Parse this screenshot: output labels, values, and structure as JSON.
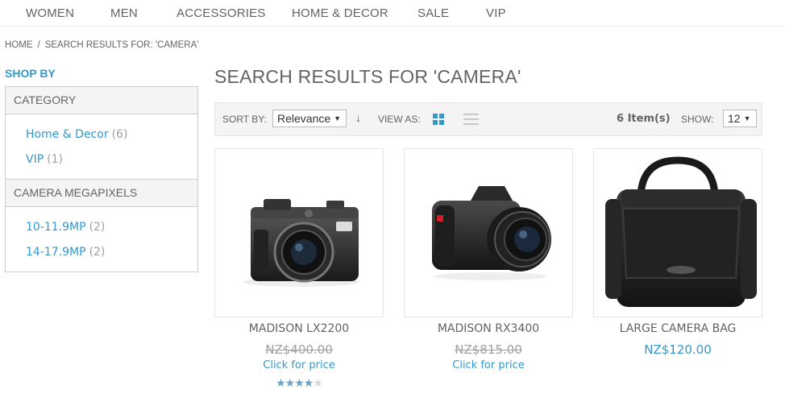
{
  "nav": {
    "items": [
      "WOMEN",
      "MEN",
      "ACCESSORIES",
      "HOME & DECOR",
      "SALE",
      "VIP"
    ]
  },
  "breadcrumb": {
    "home": "HOME",
    "separator": "/",
    "current": "SEARCH RESULTS FOR: 'CAMERA'"
  },
  "sidebar": {
    "heading": "SHOP BY",
    "groups": [
      {
        "title": "CATEGORY",
        "items": [
          {
            "label": "Home & Decor",
            "count": "(6)"
          },
          {
            "label": "VIP",
            "count": "(1)"
          }
        ]
      },
      {
        "title": "CAMERA MEGAPIXELS",
        "items": [
          {
            "label": "10-11.9MP",
            "count": "(2)"
          },
          {
            "label": "14-17.9MP",
            "count": "(2)"
          }
        ]
      }
    ]
  },
  "main": {
    "title": "SEARCH RESULTS FOR 'CAMERA'"
  },
  "toolbar": {
    "sort_label": "SORT BY:",
    "sort_value": "Relevance",
    "sort_direction_icon": "arrow-down-icon",
    "view_label": "VIEW AS:",
    "view_grid_icon": "grid-view-icon",
    "view_list_icon": "list-view-icon",
    "items_count": "6 Item(s)",
    "show_label": "SHOW:",
    "show_value": "12"
  },
  "products": [
    {
      "name": "MADISON LX2200",
      "old_price": "NZ$400.00",
      "price_link": "Click for price",
      "rating": 0.8,
      "image_icon": "compact-camera-image"
    },
    {
      "name": "MADISON RX3400",
      "old_price": "NZ$815.00",
      "price_link": "Click for price",
      "image_icon": "dslr-camera-image"
    },
    {
      "name": "LARGE CAMERA BAG",
      "price": "NZ$120.00",
      "image_icon": "camera-bag-image"
    }
  ],
  "colors": {
    "accent": "#3399cc",
    "text": "#636363",
    "muted": "#a0a0a0",
    "toolbar_bg": "#f4f4f4"
  }
}
